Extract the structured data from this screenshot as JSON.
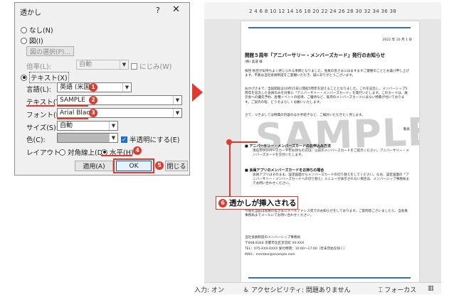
{
  "dialog": {
    "title": "透かし",
    "help": "?",
    "close": "✕",
    "none_label": "なし(N)",
    "picture_label": "図(I)",
    "select_picture_button": "図の選択(P)...",
    "scale_label": "倍率(L):",
    "scale_value": "自動",
    "washout_label": "にじみ(W)",
    "text_label": "テキスト(X)",
    "language_label": "言語(L):",
    "language_value": "英語 (米国)",
    "text_field_label": "テキスト(T):",
    "text_value": "SAMPLE",
    "font_label": "フォント(F):",
    "font_value": "Arial Black",
    "size_label": "サイズ(S):",
    "size_value": "自動",
    "color_label": "色(C):",
    "semitransparent_label": "半透明にする(E)",
    "layout_label": "レイアウト:",
    "diagonal_label": "対角線上(D)",
    "horizontal_label": "水平(H)",
    "apply_button": "適用(A)",
    "ok_button": "OK",
    "close_button": "閉じる"
  },
  "badges": [
    "1",
    "2",
    "3",
    "4",
    "5",
    "6"
  ],
  "word": {
    "ruler": "2  4  6  8  10  12  14  16  18  20  22  24  26  28  30  32  34  36  38",
    "date": "2022 年 10 月 1 日",
    "title": "開館５周年「アニバーサリー・メンバーズカード」発行のお知らせ",
    "greeting": "(株) 美波 様",
    "para1": "拝啓 秋空が気持ちよく感じられる季節となりました。会員の皆さまにはますますご健勝のこととお喜び申し上げます。平素は当社会員制度をご愛顧いただき、誠にありがとうございます。",
    "para2": "おかげさまで、当館開館は10月15日に開館5周年を迎えることとなりました。これを記念し、メンバーシップ5周年を記念した会員のみを対象に「アニバーサリー・メンバーズカード」を発行いたします。このカードは、展示会への優先予約、各種イベントの招待、ご優待など、既存のメンバーズカードにはない特典が付いております。ご案内の程、どうぞよろしくお願いいたします。",
    "para3": "さて、つきましては特典の内容のほか手続きなど、ご検討いただきたく存じます。",
    "closing": "敬具",
    "bullet1_head": "アニバーサリー・メンバーズカードのお申込み方法",
    "bullet1_body": "現在のメンバーズカードをお持ちの方は、以前のメンバーズカードをご提示ください。アニバーサリー・メンバーズカードを交付いたします。",
    "bullet2_head": "会員アプリのメンバーズカードをお持ちの場合",
    "bullet2_body": "会員アプリはそのまま、設定画面からメンバーズカードの切り替えをしてください。なお、設定画面の「アニバーサリー・メンバーズカードへの切り替え」メニューが表示されない場合は、メンバーシップ事務局までお問い合わせください。",
    "para4": "今後も当館は会員の皆さまにメールアドレス宛でのお知らせをしております。ご質問等ございましたら、当会員事務局までメールにてお問い合わせください。",
    "contact1": "当社会員制度のメンバーシップ事務局",
    "contact2": "〒608-8344 京都市北区京宮町 XX-XXX",
    "contact3": "TEL：075-XXX-XXXX 受付時間：10:00～17:00（年末年始を除く）",
    "contact4": "MAIL：member@example.com",
    "watermark": "SAMPLE"
  },
  "callout": "透かしが挿入される",
  "status": {
    "input": "入力: オン",
    "accessibility": "アクセシビリティ: 問題ありません",
    "focus": "フォーカス",
    "view_icon": "book-view-icon"
  },
  "colors": {
    "accent_red": "#e03a2f",
    "blue_bar": "#3b6fa6",
    "checkbox_blue": "#1a6fd1"
  }
}
